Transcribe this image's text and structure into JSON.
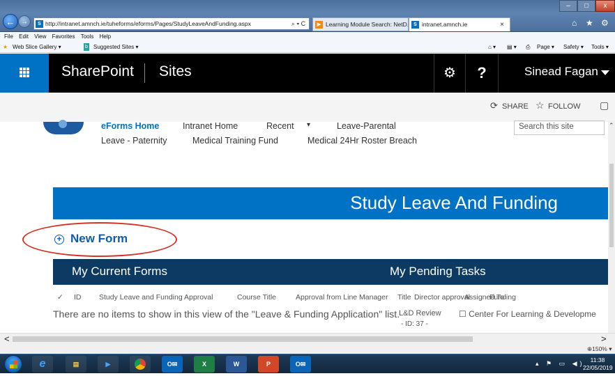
{
  "browser": {
    "address_url": "http://intranet.amnch.ie/tuheforms/eforms/Pages/StudyLeaveAndFunding.aspx",
    "address_controls": "⌕ ▾ C",
    "tabs": [
      {
        "label": "Learning Module Search: NetD...",
        "icon": "tab-favicon-orange"
      },
      {
        "label": "intranet.amnch.ie",
        "icon": "tab-favicon-sharepoint",
        "close": "×"
      }
    ],
    "window_controls": {
      "minimize": "–",
      "maximize": "□",
      "close": "x"
    },
    "toolbar_icons": {
      "home": "⌂",
      "favorites": "★",
      "settings": "⚙"
    },
    "menu": [
      "File",
      "Edit",
      "View",
      "Favorites",
      "Tools",
      "Help"
    ],
    "favorites": [
      "Web Slice Gallery ▾",
      "Suggested Sites ▾"
    ],
    "command_bar": [
      "Page ▾",
      "Safety ▾",
      "Tools ▾"
    ],
    "zoom": "⊕150%  ▾"
  },
  "suite_bar": {
    "brand": "SharePoint",
    "sites": "Sites",
    "settings_icon": "⚙",
    "help": "?",
    "user": "Sinead Fagan"
  },
  "actions": {
    "share": "SHARE",
    "follow": "FOLLOW",
    "focus_icon": "▢"
  },
  "top_nav": {
    "row1": [
      "eForms Home",
      "Intranet Home",
      "Recent",
      "▾",
      "Leave-Parental"
    ],
    "row2": [
      "Leave - Paternity",
      "Medical Training Fund",
      "Medical 24Hr Roster Breach"
    ],
    "search_placeholder": "Search this site"
  },
  "page": {
    "title": "Study Leave And Funding",
    "new_form": "New Form",
    "new_form_icon": "plus-circle-icon",
    "highlight_color": "#d43326"
  },
  "sections": {
    "left": "My Current Forms",
    "right": "My Pending Tasks"
  },
  "columns": {
    "check": "✓",
    "items": [
      "ID",
      "Study Leave and Funding Approval",
      "Course Title",
      "Approval from Line Manager",
      "Title",
      "Director approval",
      "Assigned To",
      "Funding"
    ]
  },
  "empty_message": "There are no items to show in this view of the \"Leave & Funding Application\" list.",
  "overlapping_task": {
    "title": "L&D Review",
    "id": "- ID: 37 -",
    "assigned": "☐  Center For Learning & Developme"
  },
  "scroll": {
    "left": "<",
    "right": ">",
    "up": "⌃"
  },
  "taskbar": {
    "apps": [
      "IE",
      "Explorer",
      "Media",
      "Chrome",
      "Outlook",
      "Excel",
      "Word",
      "PowerPoint",
      "Outlook"
    ],
    "tray": "▴ ⚑ ▭ ◀)",
    "time": "11:38",
    "date": "22/05/2019"
  },
  "colors": {
    "suite_blue": "#0072c6",
    "section_navy": "#0c3a63",
    "link_blue": "#0072c6"
  }
}
